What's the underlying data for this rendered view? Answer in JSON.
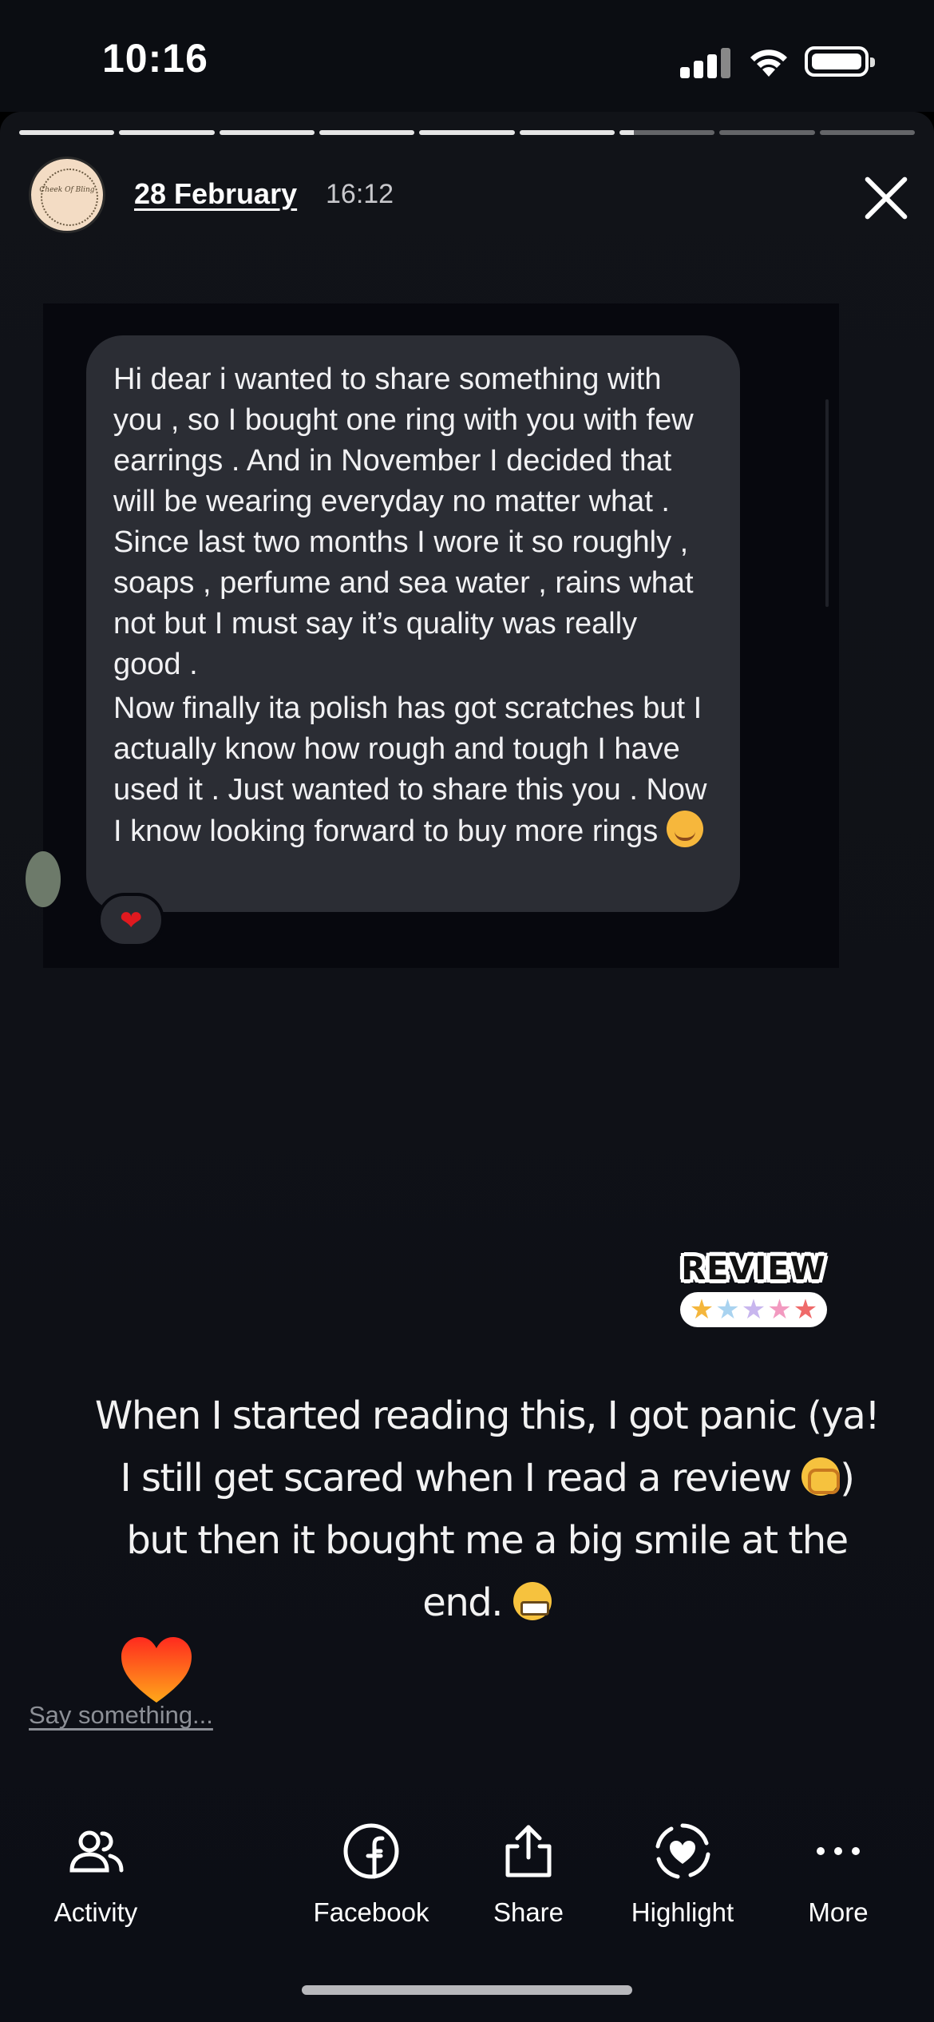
{
  "status_bar": {
    "time": "10:16"
  },
  "story": {
    "progress": {
      "segments_total": 9,
      "segments_viewed": 6,
      "current_segment_fraction": 0.15
    },
    "date": "28 February",
    "time": "16:12",
    "account_avatar_text": "Cheek Of Bling",
    "message_paragraphs": [
      "Hi dear i wanted to share something with you , so I bought one ring with you with few earrings . And in November I decided that will be wearing everyday no matter what . Since last two months I wore it so roughly , soaps , perfume and sea water , rains what not but I must say it’s quality was really good .",
      "Now finally ita polish has got scratches but I actually know how rough and tough I have used it . Just wanted to share this you . Now I know looking forward to buy more rings"
    ],
    "message_reaction": "heart",
    "sticker": {
      "word": "REVIEW",
      "stars": 5,
      "star_colors": [
        "#f4b63c",
        "#a9d3f0",
        "#c8b6ee",
        "#f29ac0",
        "#ef6a6a"
      ]
    },
    "caption_parts": [
      "When I started reading this, I got panic (ya! I still get scared when I read a review ",
      ") but then it bought me a big smile at the end. "
    ],
    "reply_placeholder": "Say something..."
  },
  "bottom_actions": [
    {
      "label": "Activity",
      "icon": "people-icon"
    },
    {
      "label": "Facebook",
      "icon": "facebook-icon"
    },
    {
      "label": "Share",
      "icon": "share-icon"
    },
    {
      "label": "Highlight",
      "icon": "highlight-icon"
    },
    {
      "label": "More",
      "icon": "more-icon"
    }
  ],
  "colors": {
    "background": "#111318",
    "bubble": "#2b2d34",
    "reaction_heart": "#e0191f",
    "reply_text": "#8c8f96"
  }
}
